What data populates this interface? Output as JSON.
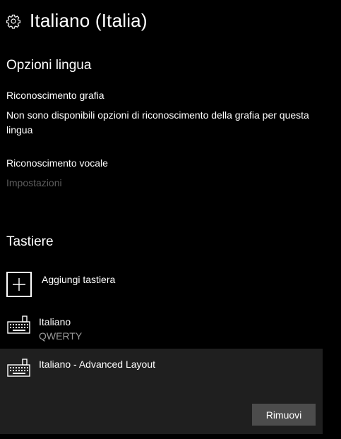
{
  "header": {
    "title": "Italiano (Italia)",
    "icon": "gear-icon"
  },
  "language_options": {
    "section_title": "Opzioni lingua",
    "handwriting": {
      "label": "Riconoscimento grafia",
      "description": "Non sono disponibili opzioni di riconoscimento della grafia per questa lingua"
    },
    "speech": {
      "label": "Riconoscimento vocale",
      "settings_link": "Impostazioni"
    }
  },
  "keyboards": {
    "section_title": "Tastiere",
    "add_label": "Aggiungi tastiera",
    "add_icon": "plus-icon",
    "items": [
      {
        "name": "Italiano",
        "layout": "QWERTY",
        "icon": "keyboard-icon",
        "selected": false
      },
      {
        "name": "Italiano - Advanced Layout",
        "layout": "",
        "icon": "keyboard-icon",
        "selected": true
      }
    ],
    "remove_label": "Rimuovi"
  },
  "colors": {
    "background": "#000000",
    "text": "#ffffff",
    "disabled_text": "#5d5d5d",
    "secondary_text": "#9a9a9a",
    "selected_row": "#1f1f1f",
    "button": "#4c4c4c"
  }
}
